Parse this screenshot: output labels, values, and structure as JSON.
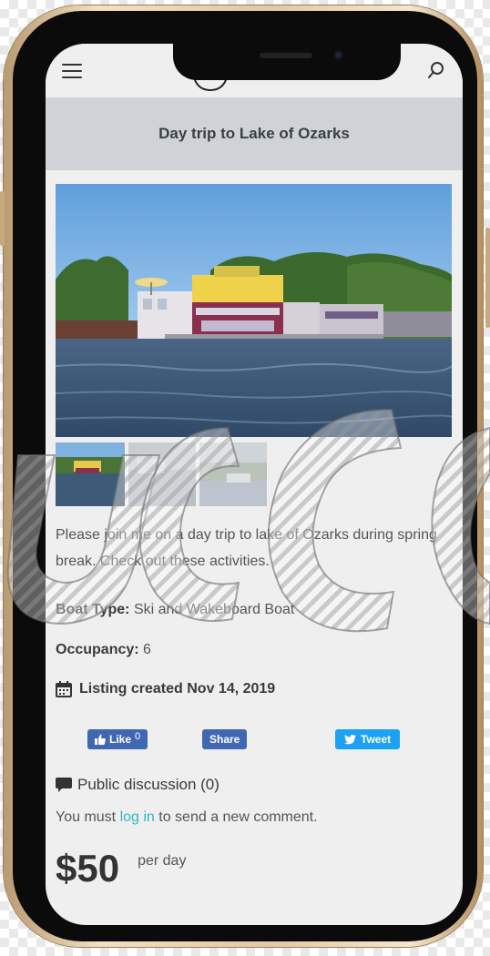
{
  "page": {
    "title": "Day trip to Lake of Ozarks"
  },
  "listing": {
    "description": "Please join me on a day trip to lake of Ozarks during spring break. Check out these activities.",
    "boat_type_label": "Boat Type:",
    "boat_type_value": "Ski and Wakeboard Boat",
    "occupancy_label": "Occupancy:",
    "occupancy_value": "6",
    "created_text": "Listing created Nov 14, 2019"
  },
  "gallery": {
    "thumbnails": 3,
    "active_index": 0
  },
  "social": {
    "like_label": "Like",
    "like_count": "0",
    "share_label": "Share",
    "tweet_label": "Tweet"
  },
  "discussion": {
    "title": "Public discussion (0)",
    "comment_prefix": "You must ",
    "login_link": "log in",
    "comment_suffix": " to send a new comment."
  },
  "pricing": {
    "amount": "$50",
    "unit": "per day"
  },
  "colors": {
    "accent_link": "#31b7c4",
    "facebook": "#4267b2",
    "twitter": "#1da1f2",
    "title_bar": "#cfd3d7",
    "phone_gold": "#e2c8a3"
  },
  "icons": [
    "menu-icon",
    "search-icon",
    "calendar-icon",
    "speech-bubble-icon",
    "facebook-thumb-icon",
    "twitter-bird-icon"
  ]
}
